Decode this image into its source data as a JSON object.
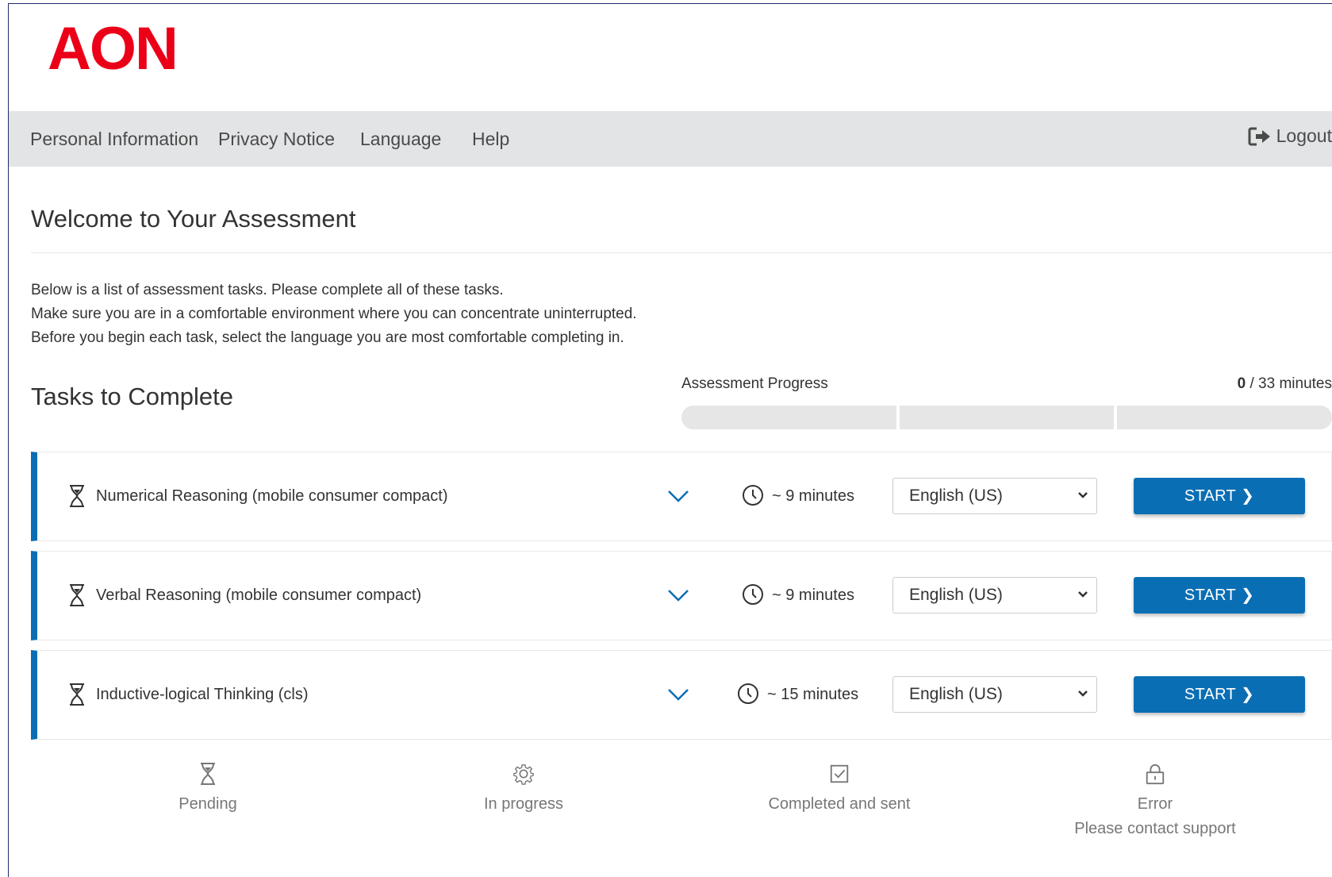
{
  "brand": {
    "logo_text": "AON",
    "logo_color": "#eb0017",
    "accent": "#0a6eb4"
  },
  "nav": {
    "items": [
      "Personal Information",
      "Privacy Notice",
      "Language",
      "Help"
    ],
    "logout_label": "Logout"
  },
  "page": {
    "title": "Welcome to Your Assessment",
    "intro": [
      "Below is a list of assessment tasks. Please complete all of these tasks.",
      "Make sure you are in a comfortable environment where you can concentrate uninterrupted.",
      "Before you begin each task, select the language you are most comfortable completing in."
    ]
  },
  "tasks_section": {
    "title": "Tasks to Complete",
    "progress_label": "Assessment Progress",
    "progress_done": "0",
    "progress_total": " / 33 minutes",
    "progress_segments": 3,
    "progress_fraction": 0
  },
  "tasks": [
    {
      "name": "Numerical Reasoning (mobile consumer compact)",
      "duration": "~ 9 minutes",
      "language": "English (US)",
      "action": "START"
    },
    {
      "name": "Verbal Reasoning (mobile consumer compact)",
      "duration": "~ 9 minutes",
      "language": "English (US)",
      "action": "START"
    },
    {
      "name": "Inductive-logical Thinking (cls)",
      "duration": "~ 15 minutes",
      "language": "English (US)",
      "action": "START"
    }
  ],
  "legend": [
    {
      "icon": "hourglass-icon",
      "label": "Pending",
      "sub": ""
    },
    {
      "icon": "gear-icon",
      "label": "In progress",
      "sub": ""
    },
    {
      "icon": "checkbox-icon",
      "label": "Completed and sent",
      "sub": ""
    },
    {
      "icon": "lock-icon",
      "label": "Error",
      "sub": "Please contact support"
    }
  ]
}
